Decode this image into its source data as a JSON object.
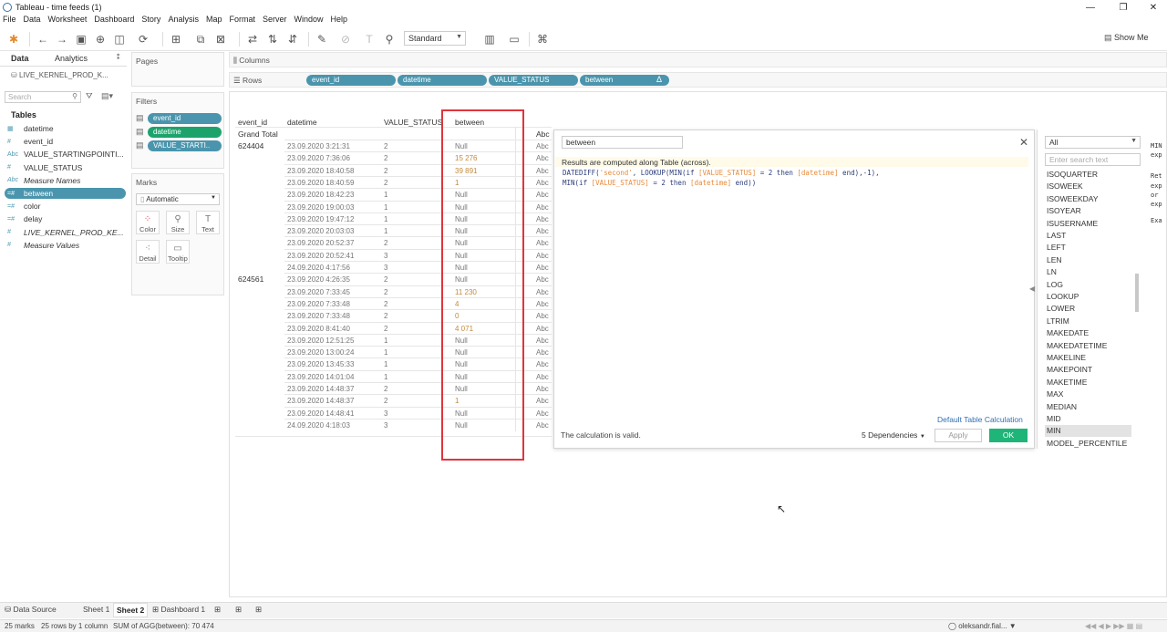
{
  "window": {
    "title": "Tableau - time feeds (1)"
  },
  "menu": [
    "File",
    "Data",
    "Worksheet",
    "Dashboard",
    "Story",
    "Analysis",
    "Map",
    "Format",
    "Server",
    "Window",
    "Help"
  ],
  "toolbar": {
    "fit": "Standard",
    "show_me": "Show Me"
  },
  "data_pane": {
    "tabs": [
      "Data",
      "Analytics"
    ],
    "datasource": "LIVE_KERNEL_PROD_K...",
    "search_placeholder": "Search",
    "tables_header": "Tables",
    "fields": [
      {
        "icon": "calendar-icon",
        "glyph": "▦",
        "name": "datetime"
      },
      {
        "icon": "number-icon",
        "glyph": "#",
        "name": "event_id"
      },
      {
        "icon": "string-icon",
        "glyph": "Abc",
        "name": "VALUE_STARTINGPOINTI..."
      },
      {
        "icon": "number-icon",
        "glyph": "#",
        "name": "VALUE_STATUS"
      },
      {
        "icon": "string-icon",
        "glyph": "Abc",
        "name": "Measure Names"
      },
      {
        "icon": "calc-icon",
        "glyph": "=#",
        "name": "between"
      },
      {
        "icon": "calc-icon",
        "glyph": "=#",
        "name": "color"
      },
      {
        "icon": "calc-icon",
        "glyph": "=#",
        "name": "delay"
      },
      {
        "icon": "number-icon",
        "glyph": "#",
        "name": "LIVE_KERNEL_PROD_KE..."
      },
      {
        "icon": "number-icon",
        "glyph": "#",
        "name": "Measure Values"
      }
    ]
  },
  "pages": {
    "title": "Pages"
  },
  "filters": {
    "title": "Filters",
    "pills": [
      "event_id",
      "datetime",
      "VALUE_STARTI.."
    ]
  },
  "marks": {
    "title": "Marks",
    "type": "Automatic",
    "buttons": [
      "Color",
      "Size",
      "Text",
      "Detail",
      "Tooltip"
    ]
  },
  "shelves": {
    "columns_label": "Columns",
    "rows_label": "Rows",
    "rows_pills": [
      "event_id",
      "datetime",
      "VALUE_STATUS",
      "between"
    ],
    "delta": "Δ"
  },
  "viz": {
    "headers": [
      "event_id",
      "datetime",
      "VALUE_STATUS",
      "between"
    ],
    "grand_total": "Grand Total",
    "abc": "Abc",
    "groups": [
      {
        "event_id": "624404",
        "rows": [
          [
            "23.09.2020 3:21:31",
            "2",
            "Null"
          ],
          [
            "23.09.2020 7:36:06",
            "2",
            "15 276"
          ],
          [
            "23.09.2020 18:40:58",
            "2",
            "39 891"
          ],
          [
            "23.09.2020 18:40:59",
            "2",
            "1"
          ],
          [
            "23.09.2020 18:42:23",
            "1",
            "Null"
          ],
          [
            "23.09.2020 19:00:03",
            "1",
            "Null"
          ],
          [
            "23.09.2020 19:47:12",
            "1",
            "Null"
          ],
          [
            "23.09.2020 20:03:03",
            "1",
            "Null"
          ],
          [
            "23.09.2020 20:52:37",
            "2",
            "Null"
          ],
          [
            "23.09.2020 20:52:41",
            "3",
            "Null"
          ],
          [
            "24.09.2020 4:17:56",
            "3",
            "Null"
          ]
        ]
      },
      {
        "event_id": "624561",
        "rows": [
          [
            "23.09.2020 4:26:35",
            "2",
            "Null"
          ],
          [
            "23.09.2020 7:33:45",
            "2",
            "11 230"
          ],
          [
            "23.09.2020 7:33:48",
            "2",
            "4"
          ],
          [
            "23.09.2020 7:33:48",
            "2",
            "0"
          ],
          [
            "23.09.2020 8:41:40",
            "2",
            "4 071"
          ],
          [
            "23.09.2020 12:51:25",
            "1",
            "Null"
          ],
          [
            "23.09.2020 13:00:24",
            "1",
            "Null"
          ],
          [
            "23.09.2020 13:45:33",
            "1",
            "Null"
          ],
          [
            "23.09.2020 14:01:04",
            "1",
            "Null"
          ],
          [
            "23.09.2020 14:48:37",
            "2",
            "Null"
          ],
          [
            "23.09.2020 14:48:37",
            "2",
            "1"
          ],
          [
            "23.09.2020 14:48:41",
            "3",
            "Null"
          ],
          [
            "24.09.2020 4:18:03",
            "3",
            "Null"
          ]
        ]
      }
    ]
  },
  "calc": {
    "name": "between",
    "note": "Results are computed along Table (across).",
    "valid": "The calculation is valid.",
    "default_table_calc": "Default Table Calculation",
    "dependencies": "5 Dependencies",
    "apply": "Apply",
    "ok": "OK"
  },
  "functions": {
    "category": "All",
    "search_placeholder": "Enter search text",
    "items": [
      "ISOQUARTER",
      "ISOWEEK",
      "ISOWEEKDAY",
      "ISOYEAR",
      "ISUSERNAME",
      "LAST",
      "LEFT",
      "LEN",
      "LN",
      "LOG",
      "LOOKUP",
      "LOWER",
      "LTRIM",
      "MAKEDATE",
      "MAKEDATETIME",
      "MAKELINE",
      "MAKEPOINT",
      "MAKETIME",
      "MAX",
      "MEDIAN",
      "MID",
      "MIN",
      "MODEL_PERCENTILE"
    ],
    "selected": "MIN",
    "help": [
      "MIN",
      "exp",
      "Ret",
      "exp",
      "or",
      "exp",
      "Exa"
    ]
  },
  "sheet_tabs": {
    "data_source": "Data Source",
    "tabs": [
      "Sheet 1",
      "Sheet 2",
      "Dashboard 1"
    ],
    "active": "Sheet 2"
  },
  "status": {
    "marks": "25 marks",
    "rows": "25 rows by 1 column",
    "sum": "SUM of AGG(between): 70 474",
    "user": "oleksandr.fial..."
  }
}
